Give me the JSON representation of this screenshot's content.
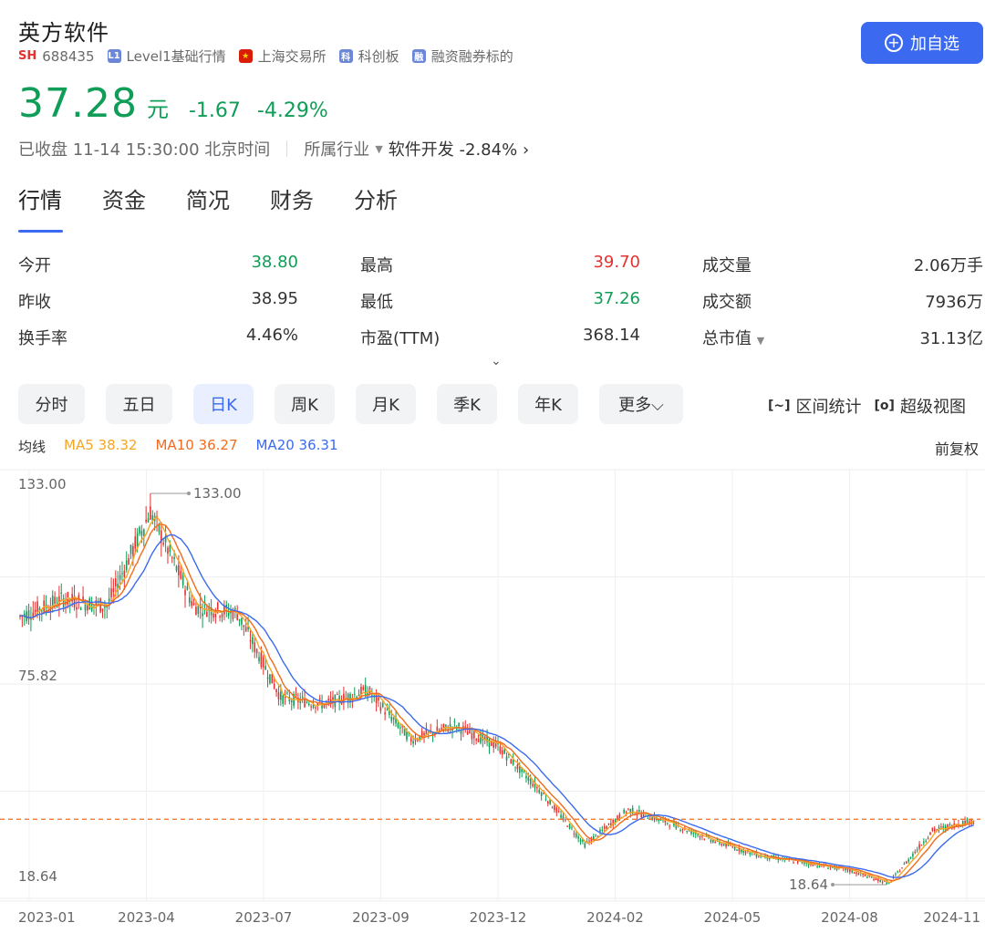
{
  "stock": {
    "name": "英方软件",
    "exchange_code": "SH",
    "code": "688435",
    "tags": [
      {
        "icon": "L1",
        "label": "Level1基础行情"
      },
      {
        "icon": "flag",
        "label": "上海交易所"
      },
      {
        "icon": "科",
        "label": "科创板"
      },
      {
        "icon": "融",
        "label": "融资融券标的"
      }
    ],
    "add_button": "加自选",
    "price": "37.28",
    "unit": "元",
    "change": "-1.67",
    "change_pct": "-4.29%",
    "status": "已收盘 11-14 15:30:00 北京时间",
    "industry_label": "所属行业",
    "industry_name": "软件开发",
    "industry_change": "-2.84%",
    "industry_arrow": "›"
  },
  "tabs": [
    "行情",
    "资金",
    "简况",
    "财务",
    "分析"
  ],
  "stats": [
    [
      {
        "label": "今开",
        "value": "38.80",
        "color": "#0f9d58"
      },
      {
        "label": "最高",
        "value": "39.70",
        "color": "#e33232"
      },
      {
        "label": "成交量",
        "value": "2.06万手",
        "color": "#333333"
      }
    ],
    [
      {
        "label": "昨收",
        "value": "38.95",
        "color": "#333333"
      },
      {
        "label": "最低",
        "value": "37.26",
        "color": "#0f9d58"
      },
      {
        "label": "成交额",
        "value": "7936万",
        "color": "#333333"
      }
    ],
    [
      {
        "label": "换手率",
        "value": "4.46%",
        "color": "#333333"
      },
      {
        "label": "市盈(TTM)",
        "value": "368.14",
        "color": "#333333"
      },
      {
        "label": "总市值",
        "value": "31.13亿",
        "color": "#333333"
      }
    ]
  ],
  "expand_icon": "⌄",
  "kline_tabs": [
    {
      "label": "分时",
      "active": false
    },
    {
      "label": "五日",
      "active": false
    },
    {
      "label": "日K",
      "active": true
    },
    {
      "label": "周K",
      "active": false
    },
    {
      "label": "月K",
      "active": false
    },
    {
      "label": "季K",
      "active": false
    },
    {
      "label": "年K",
      "active": false
    },
    {
      "label": "更多⌵",
      "active": false
    }
  ],
  "tools": {
    "range_stats": "区间统计",
    "super_view": "超级视图"
  },
  "ma": {
    "label": "均线",
    "ma5": "MA5 38.32",
    "ma10": "MA10 36.27",
    "ma20": "MA20 36.31"
  },
  "adjust": "前复权",
  "colors": {
    "up": "#e33232",
    "down": "#0f9d58",
    "ma5": "#f5a623",
    "ma10": "#f26b1d",
    "ma20": "#3b6af0",
    "accent": "#3b6af0"
  },
  "chart_data": {
    "type": "candlestick",
    "y_axis_labels": [
      "133.00",
      "75.82",
      "18.64"
    ],
    "ylim": [
      18.64,
      133.0
    ],
    "x_ticks": [
      "2023-01",
      "2023-04",
      "2023-07",
      "2023-09",
      "2023-12",
      "2024-02",
      "2024-05",
      "2024-08",
      "2024-11"
    ],
    "max_annotation": "133.00",
    "min_annotation": "18.64",
    "last_price": 37.28,
    "price_path": [
      [
        "2023-01",
        95
      ],
      [
        "2023-02",
        100
      ],
      [
        "2023-03",
        98
      ],
      [
        "2023-04",
        125
      ],
      [
        "2023-05",
        98
      ],
      [
        "2023-06",
        96
      ],
      [
        "2023-07",
        72
      ],
      [
        "2023-08",
        70
      ],
      [
        "2023-09",
        74
      ],
      [
        "2023-10",
        60
      ],
      [
        "2023-11",
        64
      ],
      [
        "2023-12",
        58
      ],
      [
        "2024-01",
        45
      ],
      [
        "2024-02",
        30
      ],
      [
        "2024-03",
        40
      ],
      [
        "2024-04",
        36
      ],
      [
        "2024-05",
        31
      ],
      [
        "2024-06",
        27
      ],
      [
        "2024-07",
        25
      ],
      [
        "2024-08",
        23
      ],
      [
        "2024-09",
        19
      ],
      [
        "2024-10",
        34
      ],
      [
        "2024-11",
        37.28
      ]
    ]
  }
}
